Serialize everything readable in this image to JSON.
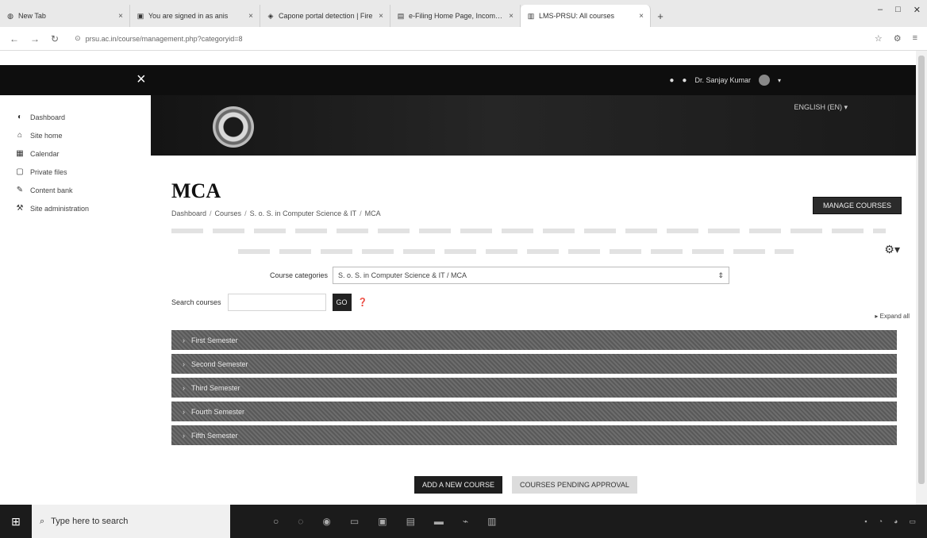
{
  "browser": {
    "tabs": [
      {
        "label": "New Tab",
        "icon": "globe-icon"
      },
      {
        "label": "You are signed in as anis",
        "icon": "page-icon"
      },
      {
        "label": "Capone portal detection | Fire",
        "icon": "shield-icon"
      },
      {
        "label": "e-Filing Home Page, Income T",
        "icon": "page-icon"
      },
      {
        "label": "LMS-PRSU: All courses",
        "icon": "page-icon",
        "active": true
      }
    ],
    "address": "prsu.ac.in/course/management.php?categoryid=8"
  },
  "topnav": {
    "close": "×",
    "user_name": "Dr. Sanjay Kumar"
  },
  "banner": {
    "link": "ENGLISH (EN) ▾"
  },
  "drawer": {
    "items": [
      {
        "label": "Dashboard",
        "icon": "dashboard-icon"
      },
      {
        "label": "Site home",
        "icon": "home-icon"
      },
      {
        "label": "Calendar",
        "icon": "calendar-icon"
      },
      {
        "label": "Private files",
        "icon": "file-icon"
      },
      {
        "label": "Content bank",
        "icon": "content-bank-icon"
      },
      {
        "label": "Site administration",
        "icon": "wrench-icon"
      }
    ]
  },
  "page": {
    "title": "MCA",
    "breadcrumb": [
      "Dashboard",
      "Courses",
      "S. o. S. in Computer Science & IT",
      "MCA"
    ],
    "manage_courses": "MANAGE COURSES",
    "course_categories_label": "Course categories",
    "course_categories_value": "S. o. S. in Computer Science & IT / MCA",
    "search_label": "Search courses",
    "go_label": "GO",
    "expand_all": "Expand all",
    "categories": [
      "First Semester",
      "Second Semester",
      "Third Semester",
      "Fourth Semester",
      "Fifth Semester"
    ],
    "add_new_course": "ADD A NEW COURSE",
    "courses_pending": "COURSES PENDING APPROVAL"
  },
  "taskbar": {
    "search_placeholder": "Type here to search"
  }
}
